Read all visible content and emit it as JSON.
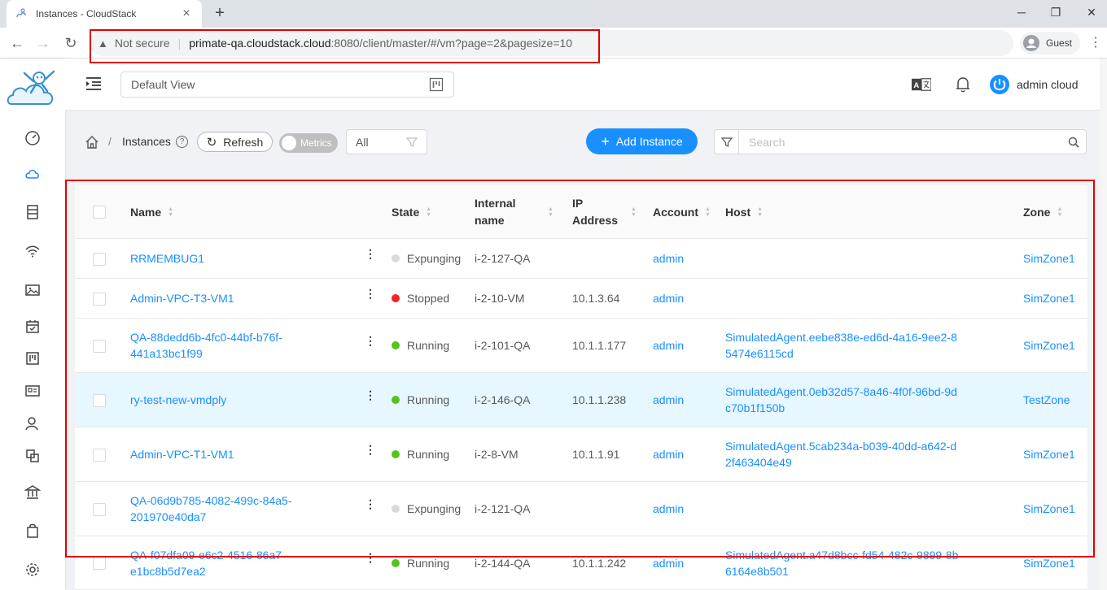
{
  "browser": {
    "tab_title": "Instances - CloudStack",
    "close_glyph": "×",
    "newtab_glyph": "+",
    "omnibox": {
      "warning": "▲",
      "not_secure": "Not secure",
      "separator": "|",
      "host": "primate-qa.cloudstack.cloud",
      "path": ":8080/client/master/#/vm?page=2&pagesize=10"
    },
    "profile": "Guest",
    "menu_glyph": "⋮",
    "back_glyph": "←",
    "forward_glyph": "→",
    "reload_glyph": "↻",
    "minimize_glyph": "─",
    "maximize_glyph": "❐",
    "close_window_glyph": "✕"
  },
  "header": {
    "project_selector": "Default View",
    "user": "admin cloud"
  },
  "breadcrumb": {
    "separator": "/",
    "title": "Instances",
    "help_glyph": "?"
  },
  "toolbar": {
    "refresh_label": "Refresh",
    "refresh_glyph": "↻",
    "metrics_label": "Metrics",
    "filter_value": "All",
    "add_label": "Add Instance",
    "add_glyph": "+",
    "search_placeholder": "Search"
  },
  "colors": {
    "accent": "#1890ff",
    "running": "#52c41a",
    "stopped": "#f5222d",
    "expunging": "#d9d9d9",
    "highlight": "#e00000"
  },
  "table": {
    "columns": [
      "Name",
      "State",
      "Internal name",
      "IP Address",
      "Account",
      "Host",
      "Zone"
    ],
    "sort_glyph_up": "▲",
    "sort_glyph_down": "▼",
    "row_actions_glyph": "⋮",
    "rows": [
      {
        "name": "RRMEMBUG1",
        "state": "Expunging",
        "internal": "i-2-127-QA",
        "ip": "",
        "account": "admin",
        "host": "",
        "zone": "SimZone1"
      },
      {
        "name": "Admin-VPC-T3-VM1",
        "state": "Stopped",
        "internal": "i-2-10-VM",
        "ip": "10.1.3.64",
        "account": "admin",
        "host": "",
        "zone": "SimZone1"
      },
      {
        "name": "QA-88dedd6b-4fc0-44bf-b76f-441a13bc1f99",
        "state": "Running",
        "internal": "i-2-101-QA",
        "ip": "10.1.1.177",
        "account": "admin",
        "host": "SimulatedAgent.eebe838e-ed6d-4a16-9ee2-85474e6115cd",
        "zone": "SimZone1"
      },
      {
        "name": "ry-test-new-vmdply",
        "state": "Running",
        "internal": "i-2-146-QA",
        "ip": "10.1.1.238",
        "account": "admin",
        "host": "SimulatedAgent.0eb32d57-8a46-4f0f-96bd-9dc70b1f150b",
        "zone": "TestZone"
      },
      {
        "name": "Admin-VPC-T1-VM1",
        "state": "Running",
        "internal": "i-2-8-VM",
        "ip": "10.1.1.91",
        "account": "admin",
        "host": "SimulatedAgent.5cab234a-b039-40dd-a642-d2f463404e49",
        "zone": "SimZone1"
      },
      {
        "name": "QA-06d9b785-4082-499c-84a5-201970e40da7",
        "state": "Expunging",
        "internal": "i-2-121-QA",
        "ip": "",
        "account": "admin",
        "host": "",
        "zone": "SimZone1"
      },
      {
        "name": "QA-f07dfa09-e6c2-4516-86a7-e1bc8b5d7ea2",
        "state": "Running",
        "internal": "i-2-144-QA",
        "ip": "10.1.1.242",
        "account": "admin",
        "host": "SimulatedAgent.a47d8bcc-fd54-482c-9899-8b6164e8b501",
        "zone": "SimZone1"
      }
    ]
  }
}
